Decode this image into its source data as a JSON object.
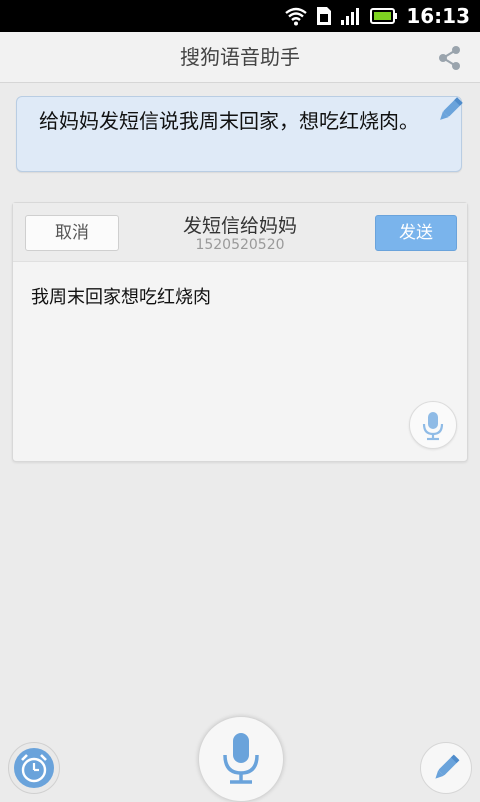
{
  "status_bar": {
    "time": "16:13"
  },
  "header": {
    "title": "搜狗语音助手"
  },
  "query": {
    "text": "给妈妈发短信说我周末回家，想吃红烧肉。"
  },
  "sms_card": {
    "cancel_label": "取消",
    "title": "发短信给妈妈",
    "phone": "1520520520",
    "send_label": "发送",
    "message": "我周末回家想吃红烧肉"
  },
  "colors": {
    "accent": "#7ab4ec",
    "icon_blue": "#6aa3db",
    "bubble_bg": "#dfeaf7"
  }
}
